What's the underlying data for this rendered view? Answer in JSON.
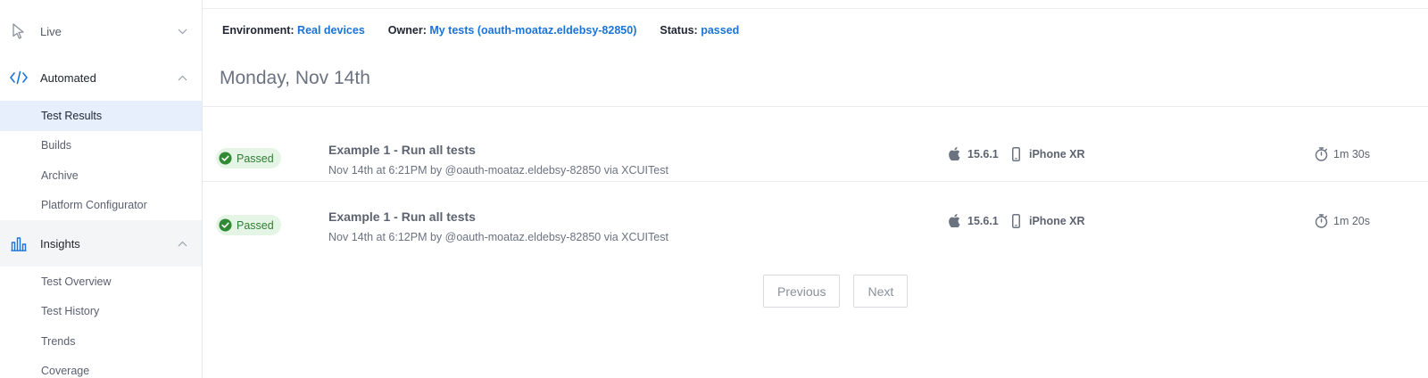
{
  "sidebar": {
    "live": {
      "label": "Live"
    },
    "automated": {
      "label": "Automated",
      "items": [
        "Test Results",
        "Builds",
        "Archive",
        "Platform Configurator"
      ]
    },
    "insights": {
      "label": "Insights",
      "items": [
        "Test Overview",
        "Test History",
        "Trends",
        "Coverage"
      ]
    },
    "active_item": "Test Results"
  },
  "filters": {
    "environment": {
      "key": "Environment:",
      "value": "Real devices"
    },
    "owner": {
      "key": "Owner:",
      "value": "My tests (oauth-moataz.eldebsy-82850)"
    },
    "status": {
      "key": "Status:",
      "value": "passed"
    }
  },
  "date_heading": "Monday, Nov 14th",
  "tests": [
    {
      "status": "Passed",
      "title": "Example 1 - Run all tests",
      "meta": "Nov 14th at 6:21PM by @oauth-moataz.eldebsy-82850 via XCUITest",
      "os_version": "15.6.1",
      "device": "iPhone XR",
      "duration": "1m 30s"
    },
    {
      "status": "Passed",
      "title": "Example 1 - Run all tests",
      "meta": "Nov 14th at 6:12PM by @oauth-moataz.eldebsy-82850 via XCUITest",
      "os_version": "15.6.1",
      "device": "iPhone XR",
      "duration": "1m 20s"
    }
  ],
  "pagination": {
    "previous": "Previous",
    "next": "Next"
  },
  "colors": {
    "accent": "#1a73d9",
    "passed_bg": "#e4f5e6",
    "passed_fg": "#2f7d32",
    "active_bg": "#e6effb"
  },
  "icons": {
    "live": "cursor-icon",
    "automated": "code-icon",
    "insights": "bar-chart-icon",
    "os": "apple-icon",
    "device": "phone-icon",
    "duration": "stopwatch-icon",
    "status": "check-circle-icon"
  }
}
